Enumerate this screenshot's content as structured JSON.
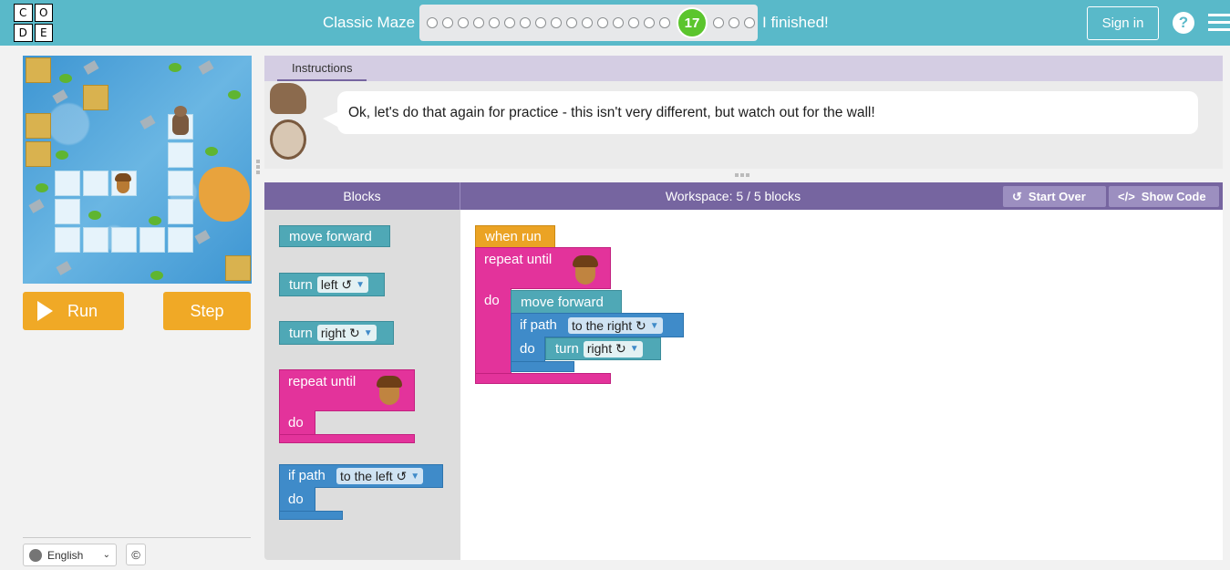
{
  "header": {
    "logo_letters": [
      "C",
      "O",
      "D",
      "E"
    ],
    "level_title": "Classic Maze",
    "progress": {
      "dots_before": 16,
      "current": "17",
      "dots_after": 3
    },
    "finished_label": "I finished!",
    "signin_label": "Sign in",
    "help_label": "?"
  },
  "game": {
    "run_label": "Run",
    "step_label": "Step"
  },
  "footer": {
    "language": "English",
    "copyright": "©"
  },
  "instructions": {
    "tab_label": "Instructions",
    "text": "Ok, let's do that again for practice - this isn't very different, but watch out for the wall!"
  },
  "workspace_header": {
    "blocks_label": "Blocks",
    "workspace_label": "Workspace: 5 / 5 blocks",
    "start_over_label": "Start Over",
    "show_code_label": "Show Code"
  },
  "toolbox": {
    "move_forward": "move forward",
    "turn_left_kw": "turn",
    "turn_left_val": "left ↺",
    "turn_right_kw": "turn",
    "turn_right_val": "right ↻",
    "repeat_until": "repeat until",
    "repeat_do": "do",
    "if_path": "if path",
    "if_path_val": "to the left ↺",
    "if_do": "do"
  },
  "program": {
    "when_run": "when run",
    "repeat_until": "repeat until",
    "repeat_do": "do",
    "move_forward": "move forward",
    "if_path": "if path",
    "if_path_val": "to the right ↻",
    "if_do": "do",
    "turn_kw": "turn",
    "turn_val": "right ↻"
  },
  "colors": {
    "header": "#59b9c9",
    "accent_purple": "#7665a0",
    "run_button": "#f0a926",
    "block_teal": "#4fa8b6",
    "block_pink": "#e3339b",
    "block_blue": "#3f8bc9",
    "block_orange": "#eba324",
    "current_level": "#5bc52d"
  }
}
